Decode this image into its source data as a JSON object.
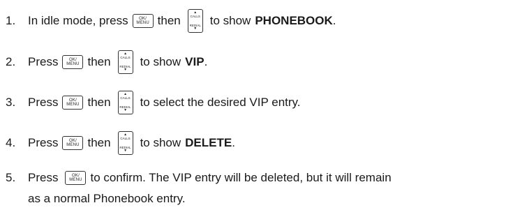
{
  "keys": {
    "ok_line1": "OK/",
    "ok_line2": "MENU",
    "nav_top": "CALLS",
    "nav_bottom": "REDIAL",
    "nav_up_arrow": "▲",
    "nav_down_arrow": "▼"
  },
  "steps": [
    {
      "number": "1.",
      "prefix": "In idle mode, press",
      "connector": "then",
      "suffix": "to show",
      "bold": "PHONEBOOK",
      "end": "."
    },
    {
      "number": "2.",
      "prefix": "Press",
      "connector": "then",
      "suffix": "to show",
      "bold": "VIP",
      "end": "."
    },
    {
      "number": "3.",
      "prefix": "Press",
      "connector": "then",
      "suffix": "to select the desired VIP entry."
    },
    {
      "number": "4.",
      "prefix": "Press",
      "connector": "then",
      "suffix": "to show",
      "bold": "DELETE",
      "end": "."
    },
    {
      "number": "5.",
      "prefix": "Press",
      "suffix": "to confirm. The VIP entry will be deleted, but it will remain",
      "continuation": "as a normal Phonebook entry."
    }
  ]
}
